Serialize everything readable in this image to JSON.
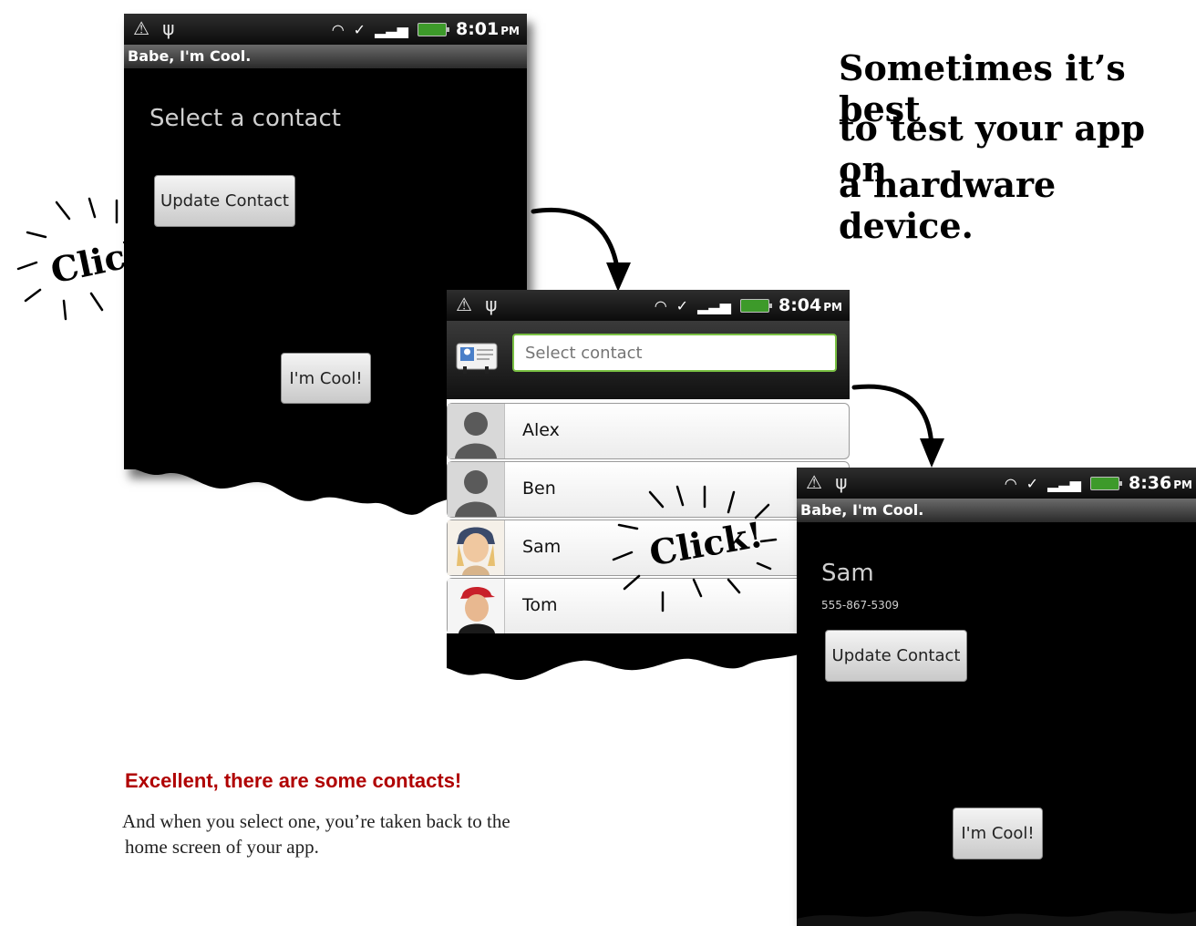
{
  "screen1": {
    "status": {
      "time": "8:01",
      "ampm": "PM"
    },
    "title": "Babe, I'm Cool.",
    "prompt": "Select a contact",
    "update_button": "Update Contact",
    "cool_button": "I'm Cool!"
  },
  "screen2": {
    "status": {
      "time": "8:04",
      "ampm": "PM"
    },
    "search_placeholder": "Select contact",
    "contacts": [
      {
        "name": "Alex"
      },
      {
        "name": "Ben"
      },
      {
        "name": "Sam"
      },
      {
        "name": "Tom"
      }
    ]
  },
  "screen3": {
    "status": {
      "time": "8:36",
      "ampm": "PM"
    },
    "title": "Babe, I'm Cool.",
    "contact_name": "Sam",
    "contact_phone": "555-867-5309",
    "update_button": "Update Contact",
    "cool_button": "I'm Cool!"
  },
  "annotations": {
    "click1": "Click!",
    "click2": "Click!",
    "tip_line1": "Sometimes it’s best",
    "tip_line2": "to test your app on",
    "tip_line3": "a hardware device."
  },
  "caption": {
    "heading": "Excellent, there are some contacts!",
    "body_line1": "And when you select one, you’re taken back to the",
    "body_line2": "home screen of your app."
  },
  "colors": {
    "search_border": "#7ac143",
    "battery": "#3d9a2a"
  }
}
